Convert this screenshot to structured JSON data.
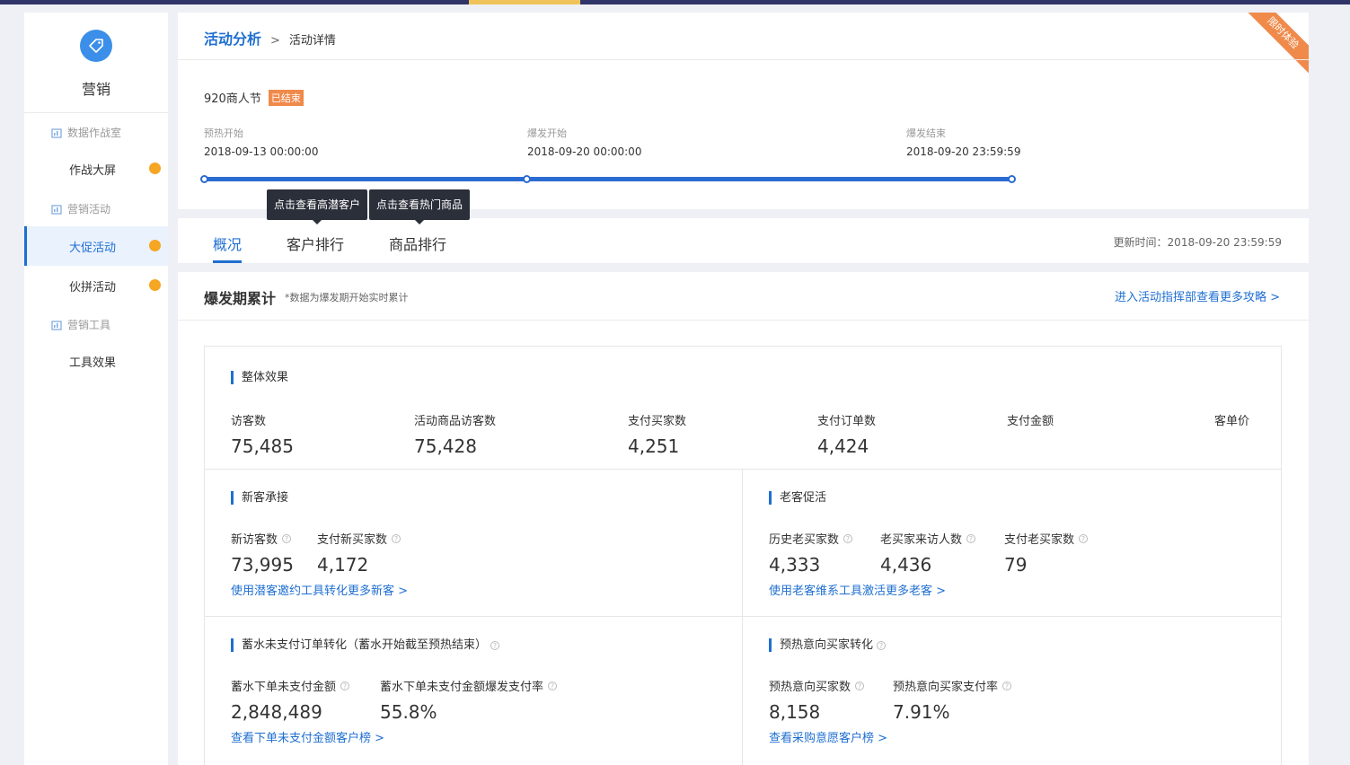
{
  "sidebar": {
    "title": "营销",
    "groups": [
      {
        "label": "数据作战室"
      },
      {
        "label": "营销活动"
      },
      {
        "label": "营销工具"
      }
    ],
    "items": [
      {
        "label": "作战大屏"
      },
      {
        "label": "大促活动"
      },
      {
        "label": "伙拼活动"
      },
      {
        "label": "工具效果"
      }
    ]
  },
  "header": {
    "breadcrumb_link": "活动分析",
    "breadcrumb_sep": ">",
    "breadcrumb_current": "活动详情",
    "ribbon": "限时体验",
    "event_name": "920商人节",
    "event_status": "已结束",
    "phases": [
      {
        "label": "预热开始",
        "time": "2018-09-13 00:00:00"
      },
      {
        "label": "爆发开始",
        "time": "2018-09-20 00:00:00"
      },
      {
        "label": "爆发结束",
        "time": "2018-09-20 23:59:59"
      }
    ]
  },
  "tooltips": [
    "点击查看高潜客户",
    "点击查看热门商品"
  ],
  "tabs": [
    {
      "label": "概况"
    },
    {
      "label": "客户排行"
    },
    {
      "label": "商品排行"
    }
  ],
  "update_time": "更新时间：2018-09-20 23:59:59",
  "section": {
    "title": "爆发期累计",
    "note": "*数据为爆发期开始实时累计",
    "guide_link": "进入活动指挥部查看更多攻略 >"
  },
  "overall": {
    "title": "整体效果",
    "metrics": [
      {
        "label": "访客数",
        "value": "75,485"
      },
      {
        "label": "活动商品访客数",
        "value": "75,428"
      },
      {
        "label": "支付买家数",
        "value": "4,251"
      },
      {
        "label": "支付订单数",
        "value": "4,424"
      },
      {
        "label": "支付金额",
        "value": ""
      },
      {
        "label": "客单价",
        "value": ""
      }
    ]
  },
  "new_customers": {
    "title": "新客承接",
    "metrics": [
      {
        "label": "新访客数",
        "value": "73,995"
      },
      {
        "label": "支付新买家数",
        "value": "4,172"
      }
    ],
    "link": "使用潜客邀约工具转化更多新客 >"
  },
  "old_customers": {
    "title": "老客促活",
    "metrics": [
      {
        "label": "历史老买家数",
        "value": "4,333"
      },
      {
        "label": "老买家来访人数",
        "value": "4,436"
      },
      {
        "label": "支付老买家数",
        "value": "79"
      }
    ],
    "link": "使用老客维系工具激活更多老客 >"
  },
  "deposit": {
    "title": "蓄水未支付订单转化（蓄水开始截至预热结束）",
    "metrics": [
      {
        "label": "蓄水下单未支付金额",
        "value": "2,848,489"
      },
      {
        "label": "蓄水下单未支付金额爆发支付率",
        "value": "55.8%"
      }
    ],
    "link": "查看下单未支付金额客户榜 >"
  },
  "preheat": {
    "title": "预热意向买家转化",
    "metrics": [
      {
        "label": "预热意向买家数",
        "value": "8,158"
      },
      {
        "label": "预热意向买家支付率",
        "value": "7.91%"
      }
    ],
    "link": "查看采购意愿客户榜 >"
  },
  "colors": {
    "accent": "#1f6fd1",
    "status_badge": "#f08a4b",
    "dot": "#f5a623",
    "topbar": "#2f3569"
  }
}
